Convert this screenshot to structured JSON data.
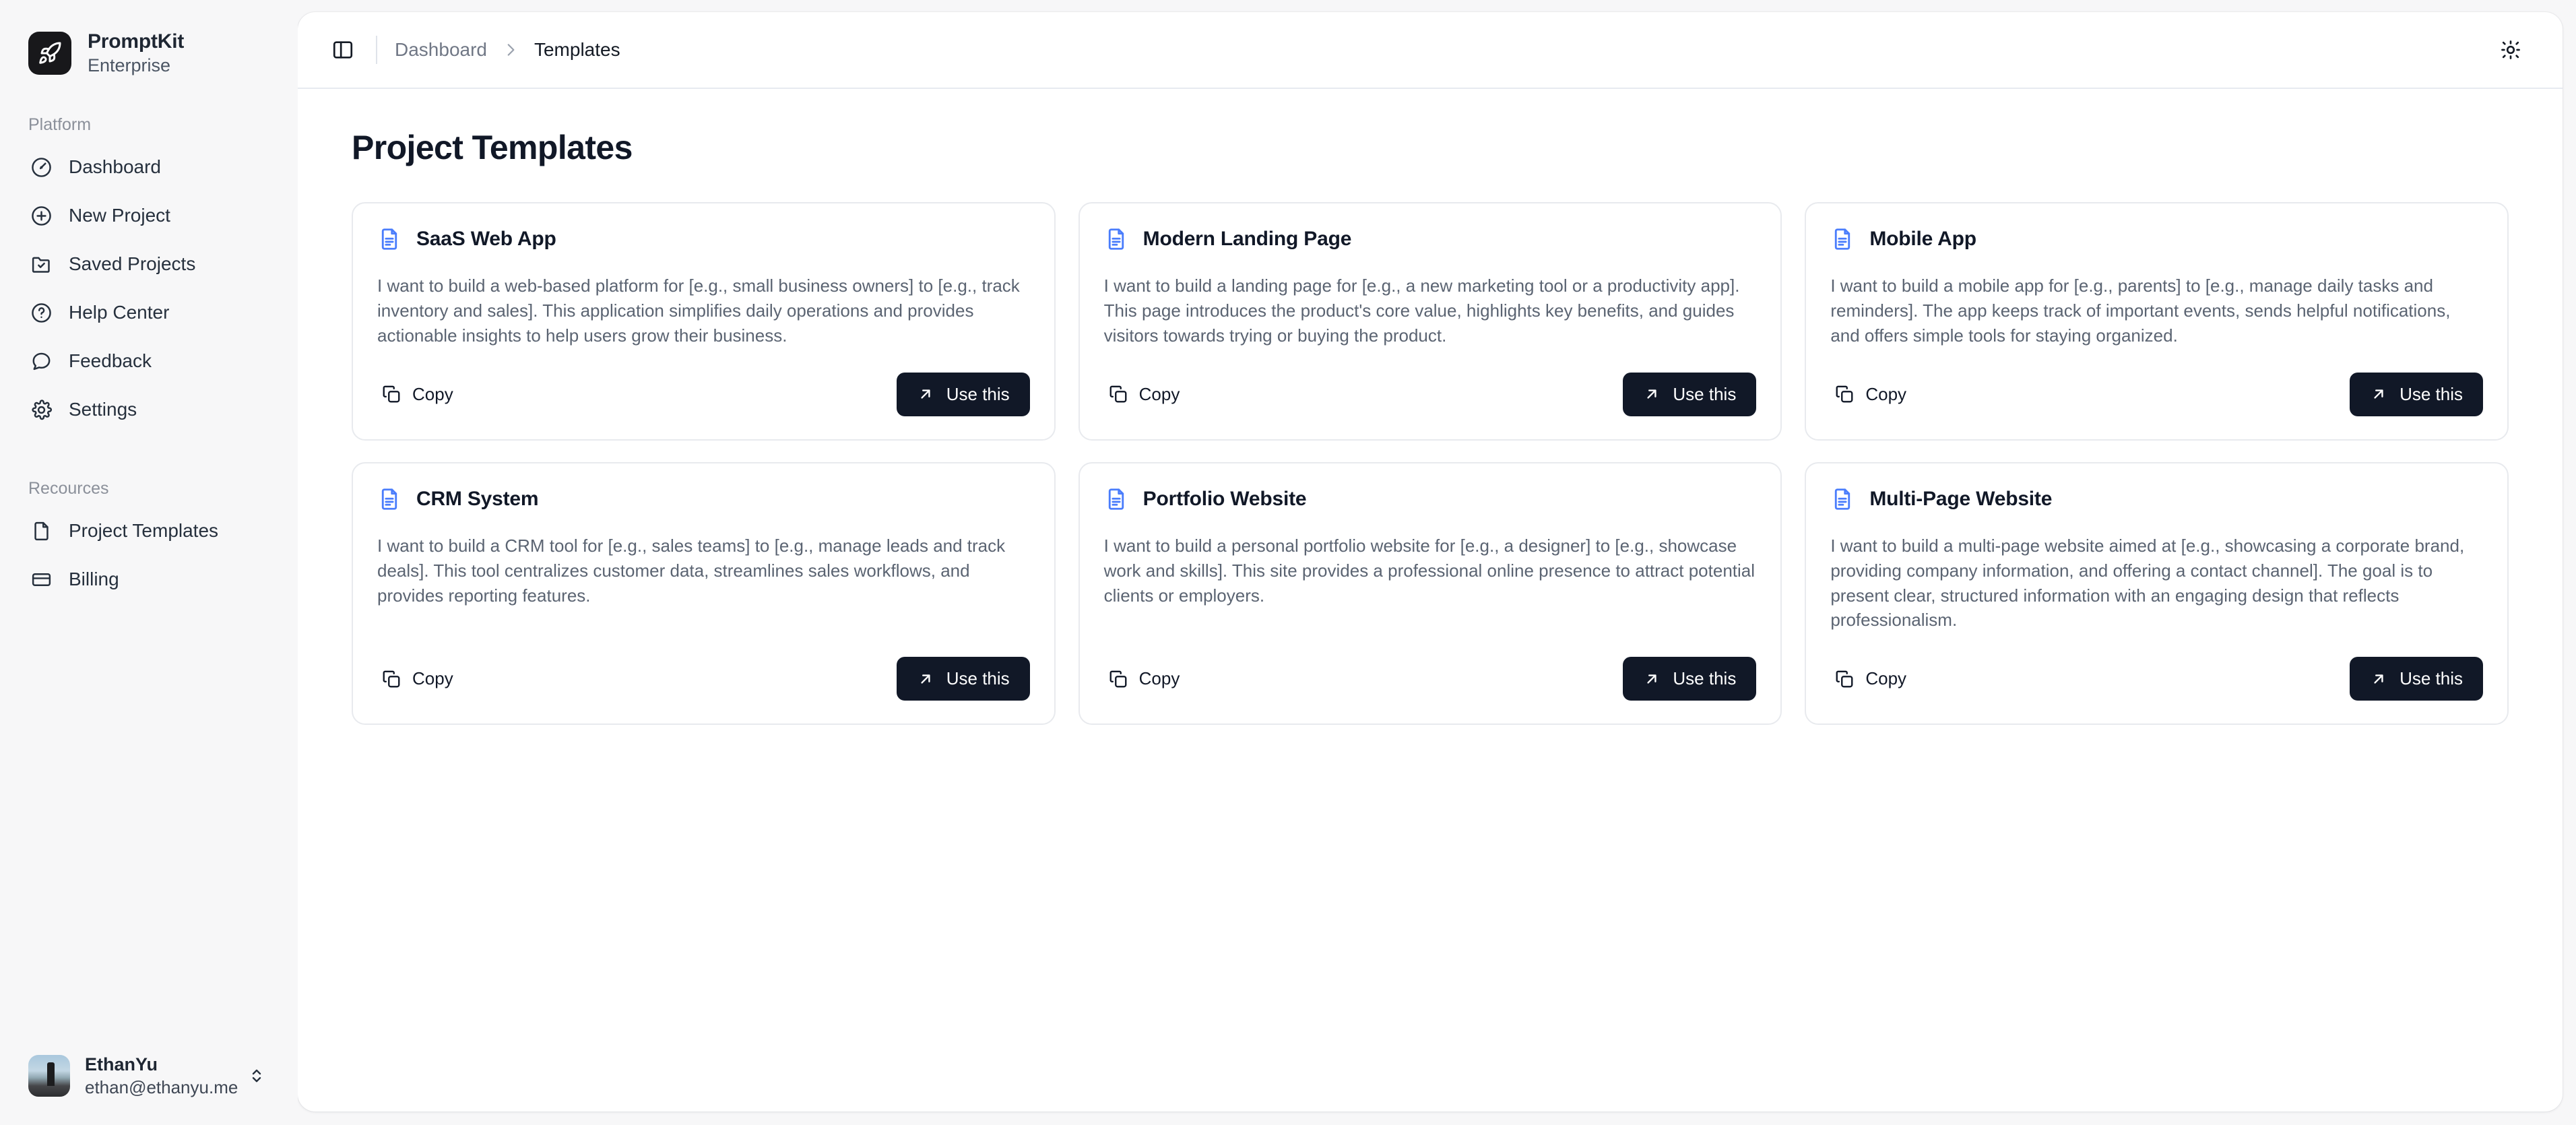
{
  "brand": {
    "name": "PromptKit",
    "plan": "Enterprise",
    "logo_icon": "rocket-icon",
    "logo_bg": "#18181b"
  },
  "sidebar": {
    "sections": [
      {
        "label": "Platform",
        "items": [
          {
            "label": "Dashboard",
            "icon": "gauge-icon"
          },
          {
            "label": "New Project",
            "icon": "circle-plus-icon"
          },
          {
            "label": "Saved Projects",
            "icon": "folder-check-icon"
          },
          {
            "label": "Help Center",
            "icon": "question-circle-icon"
          },
          {
            "label": "Feedback",
            "icon": "message-circle-icon"
          },
          {
            "label": "Settings",
            "icon": "gear-icon"
          }
        ]
      },
      {
        "label": "Recources",
        "items": [
          {
            "label": "Project Templates",
            "icon": "file-icon"
          },
          {
            "label": "Billing",
            "icon": "credit-card-icon"
          }
        ]
      }
    ],
    "user": {
      "name": "EthanYu",
      "email": "ethan@ethanyu.me",
      "avatar_alt": "user-avatar-photo",
      "switcher_icon": "chevrons-up-down-icon"
    }
  },
  "topbar": {
    "panel_toggle_icon": "sidebar-toggle-icon",
    "breadcrumb": {
      "parent": "Dashboard",
      "separator_icon": "chevron-right-icon",
      "current": "Templates"
    },
    "theme_toggle_icon": "sun-icon"
  },
  "main": {
    "page_title": "Project Templates",
    "accent_color": "#4a7dfc",
    "button_color": "#111827",
    "card_icon": "file-text-icon",
    "copy_icon": "copy-icon",
    "use_icon": "arrow-up-right-icon",
    "copy_label": "Copy",
    "use_label": "Use this",
    "templates": [
      {
        "title": "SaaS Web App",
        "description": "I want to build a web-based platform for [e.g., small business owners] to [e.g., track inventory and sales]. This application simplifies daily operations and provides actionable insights to help users grow their business.",
        "copy_label": "Copy",
        "use_label": "Use this"
      },
      {
        "title": "Modern Landing Page",
        "description": "I want to build a landing page for [e.g., a new marketing tool or a productivity app]. This page introduces the product's core value, highlights key benefits, and guides visitors towards trying or buying the product.",
        "copy_label": "Copy",
        "use_label": "Use this"
      },
      {
        "title": "Mobile App",
        "description": "I want to build a mobile app for [e.g., parents] to [e.g., manage daily tasks and reminders]. The app keeps track of important events, sends helpful notifications, and offers simple tools for staying organized.",
        "copy_label": "Copy",
        "use_label": "Use this"
      },
      {
        "title": "CRM System",
        "description": "I want to build a CRM tool for [e.g., sales teams] to [e.g., manage leads and track deals]. This tool centralizes customer data, streamlines sales workflows, and provides reporting features.",
        "copy_label": "Copy",
        "use_label": "Use this"
      },
      {
        "title": "Portfolio Website",
        "description": "I want to build a personal portfolio website for [e.g., a designer] to [e.g., showcase work and skills]. This site provides a professional online presence to attract potential clients or employers.",
        "copy_label": "Copy",
        "use_label": "Use this"
      },
      {
        "title": "Multi-Page Website",
        "description": "I want to build a multi-page website aimed at [e.g., showcasing a corporate brand, providing company information, and offering a contact channel]. The goal is to present clear, structured information with an engaging design that reflects professionalism.",
        "copy_label": "Copy",
        "use_label": "Use this"
      }
    ]
  }
}
